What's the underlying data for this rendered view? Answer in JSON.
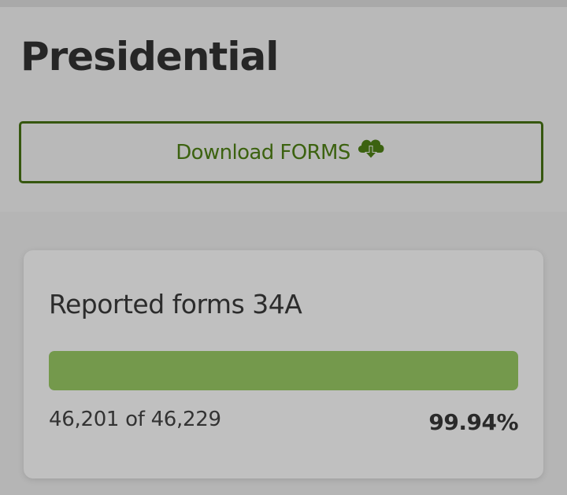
{
  "header": {
    "title": "Presidential",
    "download_button": {
      "label": "Download FORMS",
      "icon": "cloud-download-icon"
    }
  },
  "report_card": {
    "title": "Reported forms 34A",
    "progress": {
      "reported": 46201,
      "total": 46229,
      "fraction": 0.9994
    },
    "count_text": "46,201 of 46,229",
    "percent_text": "99.94%"
  },
  "colors": {
    "accent_green": "#3c6210",
    "progress_fill": "#74994c",
    "background": "#b5b5b5"
  }
}
